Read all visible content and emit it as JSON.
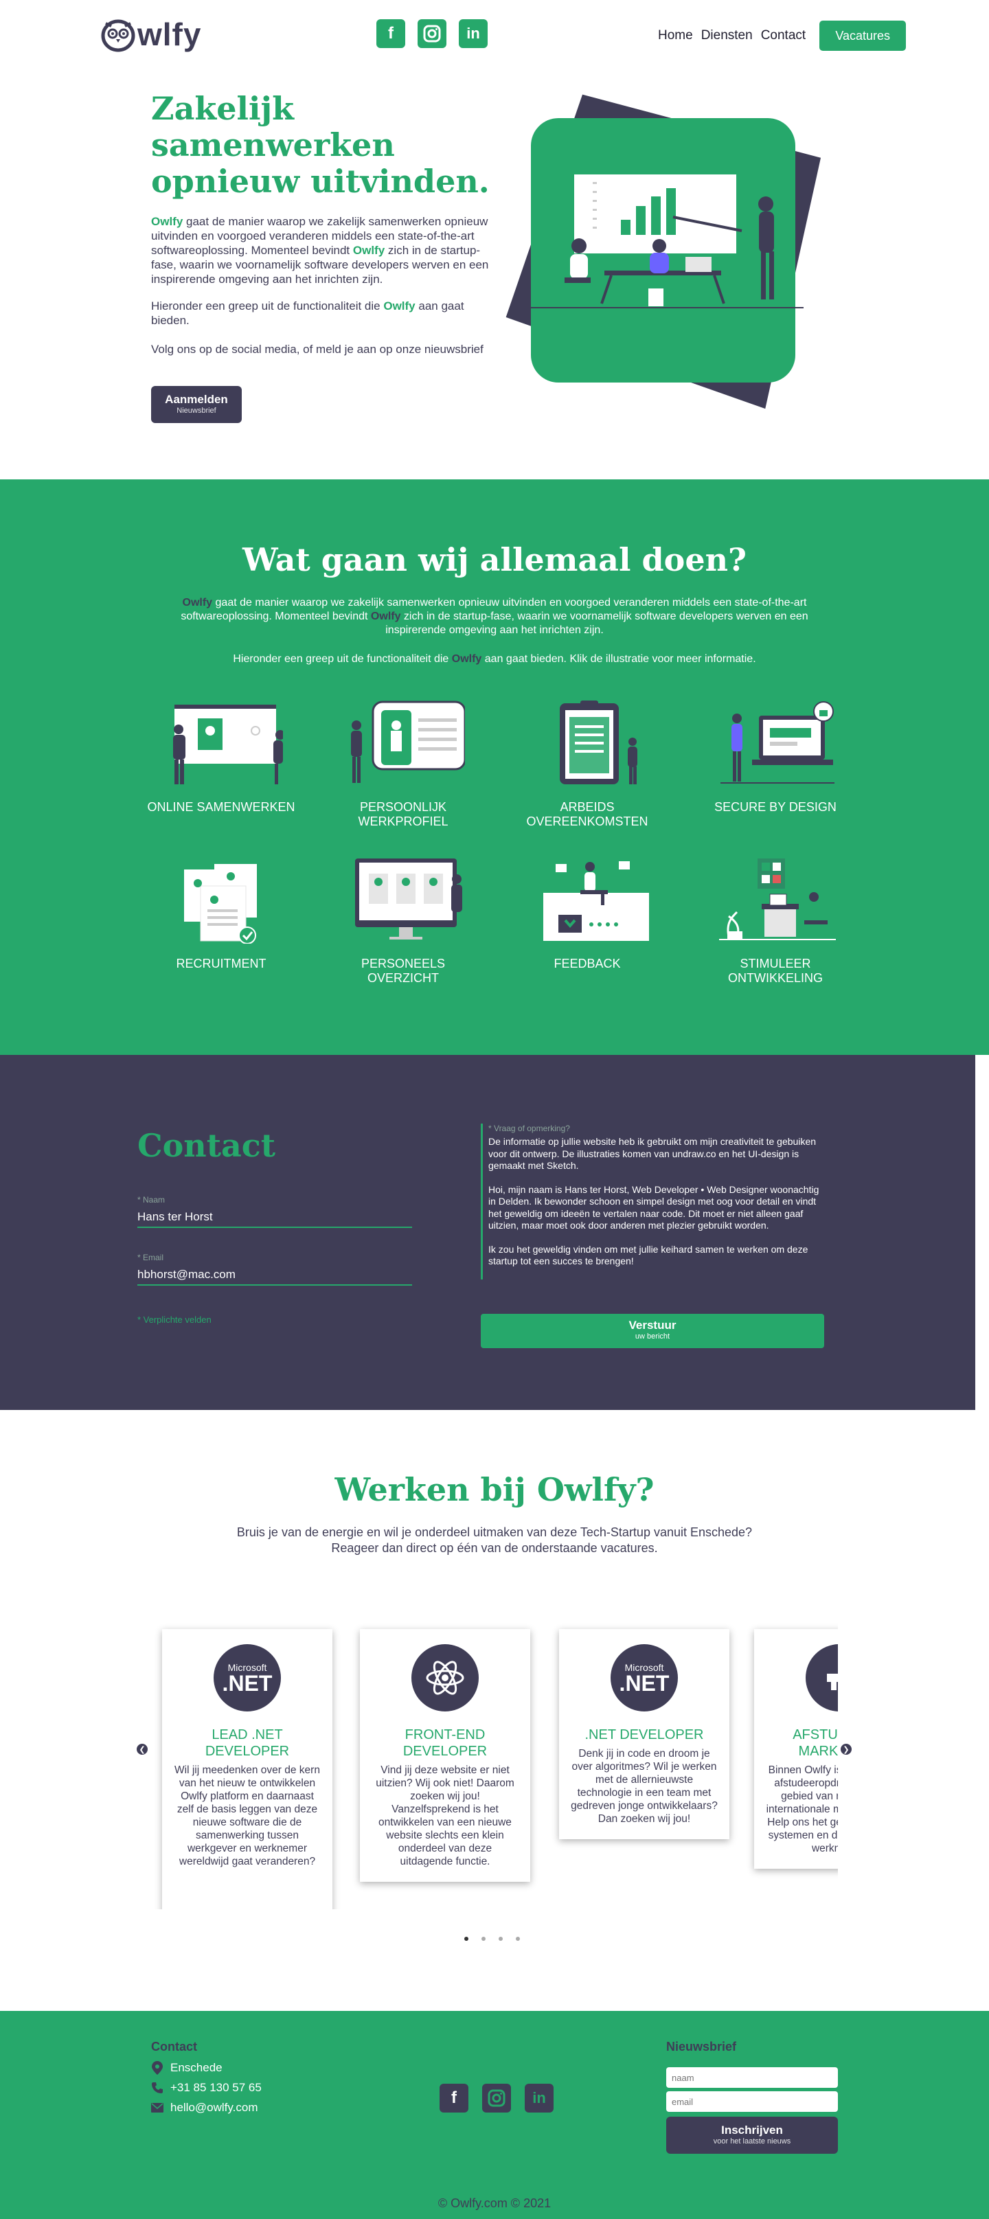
{
  "brand": {
    "logo_text": "wlfy"
  },
  "colors": {
    "green": "#26a86b",
    "dark": "#3f3d56"
  },
  "nav": {
    "social_icons": [
      "facebook-icon",
      "instagram-icon",
      "linkedin-icon"
    ],
    "links": [
      "Home",
      "Diensten",
      "Contact"
    ],
    "cta": "Vacatures"
  },
  "hero": {
    "title": "Zakelijk samenwerken opnieuw uitvinden.",
    "p1_brand": "Owlfy",
    "p1_a": " gaat de manier waarop we zakelijk samenwerken opnieuw uitvinden en voorgoed veranderen middels een state-of-the-art softwareoplossing. Momenteel bevindt ",
    "p1_brand2": "Owlfy",
    "p1_b": " zich in de startup-fase, waarin we voornamelijk software developers werven en een inspirerende omgeving aan het inrichten zijn.",
    "p2_a": "Hieronder een greep uit de functionaliteit die ",
    "p2_brand": "Owlfy",
    "p2_b": " aan gaat bieden.",
    "p3": "Volg ons op de social media, of meld je aan op onze nieuwsbrief",
    "button_main": "Aanmelden",
    "button_sub": "Nieuwsbrief"
  },
  "services": {
    "title": "Wat gaan wij allemaal doen?",
    "intro_brand": "Owlfy",
    "intro_a": " gaat de manier waarop we zakelijk samenwerken opnieuw uitvinden en voorgoed veranderen middels een state-of-the-art softwareoplossing. Momenteel bevindt ",
    "intro_brand2": "Owlfy",
    "intro_b": " zich in de startup-fase, waarin we voornamelijk software developers werven en een inspirerende omgeving aan het inrichten zijn.",
    "intro2_a": "Hieronder een greep uit de functionaliteit die ",
    "intro2_brand": "Owlfy",
    "intro2_b": " aan gaat bieden. Klik de illustratie voor meer informatie.",
    "items": [
      {
        "label": "ONLINE SAMENWERKEN"
      },
      {
        "label": "PERSOONLIJK WERKPROFIEL"
      },
      {
        "label": "ARBEIDS OVEREENKOMSTEN"
      },
      {
        "label": "SECURE BY DESIGN"
      },
      {
        "label": "RECRUITMENT"
      },
      {
        "label": "PERSONEELS OVERZICHT"
      },
      {
        "label": "FEEDBACK"
      },
      {
        "label": "STIMULEER ONTWIKKELING"
      }
    ]
  },
  "contact": {
    "title": "Contact",
    "name_label": "* Naam",
    "name_value": "Hans ter Horst",
    "email_label": "* Email",
    "email_value": "hbhorst@mac.com",
    "required_note": "* Verplichte velden",
    "message_label": "* Vraag of opmerking?",
    "message_p1": "De informatie op jullie website heb ik gebruikt om mijn creativiteit te gebuiken voor dit ontwerp. De illustraties komen van undraw.co en  het UI-design is gemaakt met Sketch.",
    "message_p2": "Hoi, mijn naam is Hans ter Horst, Web Developer • Web Designer woonachtig in Delden. Ik bewonder schoon en simpel design met oog voor detail en vindt het geweldig om ideeën te vertalen naar code. Dit moet er niet alleen gaaf uitzien, maar moet ook door anderen met plezier gebruikt worden.",
    "message_p3": "Ik zou het geweldig vinden om met jullie keihard samen te werken om deze startup tot een succes te brengen!",
    "submit_main": "Verstuur",
    "submit_sub": "uw bericht"
  },
  "jobs": {
    "title": "Werken bij Owlfy?",
    "intro": "Bruis je van de energie en wil je onderdeel uitmaken van deze Tech-Startup vanuit Enschede? Reageer dan direct op één van de onderstaande vacatures.",
    "cards": [
      {
        "icon": "dotnet-icon",
        "icon_top": "Microsoft",
        "icon_main": ".NET",
        "title": "LEAD .NET DEVELOPER",
        "text": "Wil jij meedenken over de kern van het nieuw te ontwikkelen Owlfy platform en daarnaast zelf de basis leggen van deze nieuwe software die de samenwerking tussen werkgever en werknemer wereldwijd gaat veranderen?"
      },
      {
        "icon": "react-atom-icon",
        "icon_top": "",
        "icon_main": "",
        "title": "FRONT-END DEVELOPER",
        "text": "Vind jij deze website er niet uitzien? Wij ook niet! Daarom zoeken wij jou! Vanzelfsprekend is het ontwikkelen van een nieuwe website slechts een klein onderdeel van deze uitdagende functie."
      },
      {
        "icon": "dotnet-icon",
        "icon_top": "Microsoft",
        "icon_main": ".NET",
        "title": ".NET DEVELOPER",
        "text": "Denk jij in code en droom je over algoritmes? Wil je werken met de allernieuwste technologie in een team met gedreven jonge ontwikkelaars? Dan zoeken wij jou!"
      },
      {
        "icon": "megaphone-icon",
        "icon_top": "",
        "icon_main": "",
        "title": "AFSTUDEREN MARKETING",
        "text": "Binnen Owlfy is er ruimte voor afstudeeropdrachten op het gebied van marketing en internationale marktonderzoek. Help ons het gebruik van onze systemen en de werkgever en werknemer."
      }
    ],
    "dots": 4,
    "active_dot": 0
  },
  "footer": {
    "contact_title": "Contact",
    "city": "Enschede",
    "phone": "+31 85 130 57 65",
    "email": "hello@owlfy.com",
    "newsletter_title": "Nieuwsbrief",
    "name_placeholder": "naam",
    "email_placeholder": "email",
    "button_main": "Inschrijven",
    "button_sub": "voor het laatste nieuws",
    "copyright": "© Owlfy.com © 2021"
  }
}
